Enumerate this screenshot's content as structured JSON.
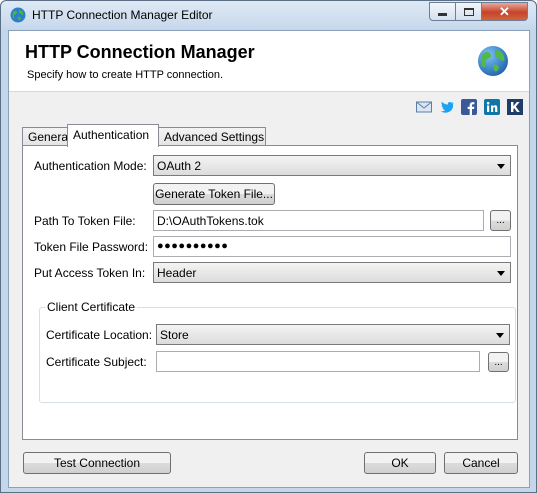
{
  "window": {
    "title": "HTTP Connection Manager Editor",
    "icon": "globe-icon"
  },
  "header": {
    "title": "HTTP Connection Manager",
    "subtitle": "Specify how to create HTTP connection."
  },
  "social": [
    "email-icon",
    "twitter-icon",
    "facebook-icon",
    "linkedin-icon",
    "kingswaysoft-icon"
  ],
  "tabs": [
    {
      "label": "General"
    },
    {
      "label": "Authentication",
      "active": true
    },
    {
      "label": "Advanced Settings"
    }
  ],
  "auth": {
    "mode_label": "Authentication Mode:",
    "mode_value": "OAuth 2",
    "generate_button": "Generate Token File...",
    "token_path_label": "Path To Token File:",
    "token_path_value": "D:\\OAuthTokens.tok",
    "browse_label": "...",
    "password_label": "Token File Password:",
    "password_value": "●●●●●●●●●●",
    "put_token_label": "Put Access Token In:",
    "put_token_value": "Header"
  },
  "client_cert": {
    "legend": "Client Certificate",
    "location_label": "Certificate Location:",
    "location_value": "Store",
    "subject_label": "Certificate Subject:",
    "subject_value": "",
    "browse_label": "..."
  },
  "footer": {
    "test_button": "Test Connection",
    "ok_button": "OK",
    "cancel_button": "Cancel"
  },
  "colors": {
    "frame": "#c4d6ea",
    "close": "#c5432b",
    "twitter": "#1da1f2",
    "facebook": "#3b5998",
    "linkedin": "#0e76a8"
  }
}
